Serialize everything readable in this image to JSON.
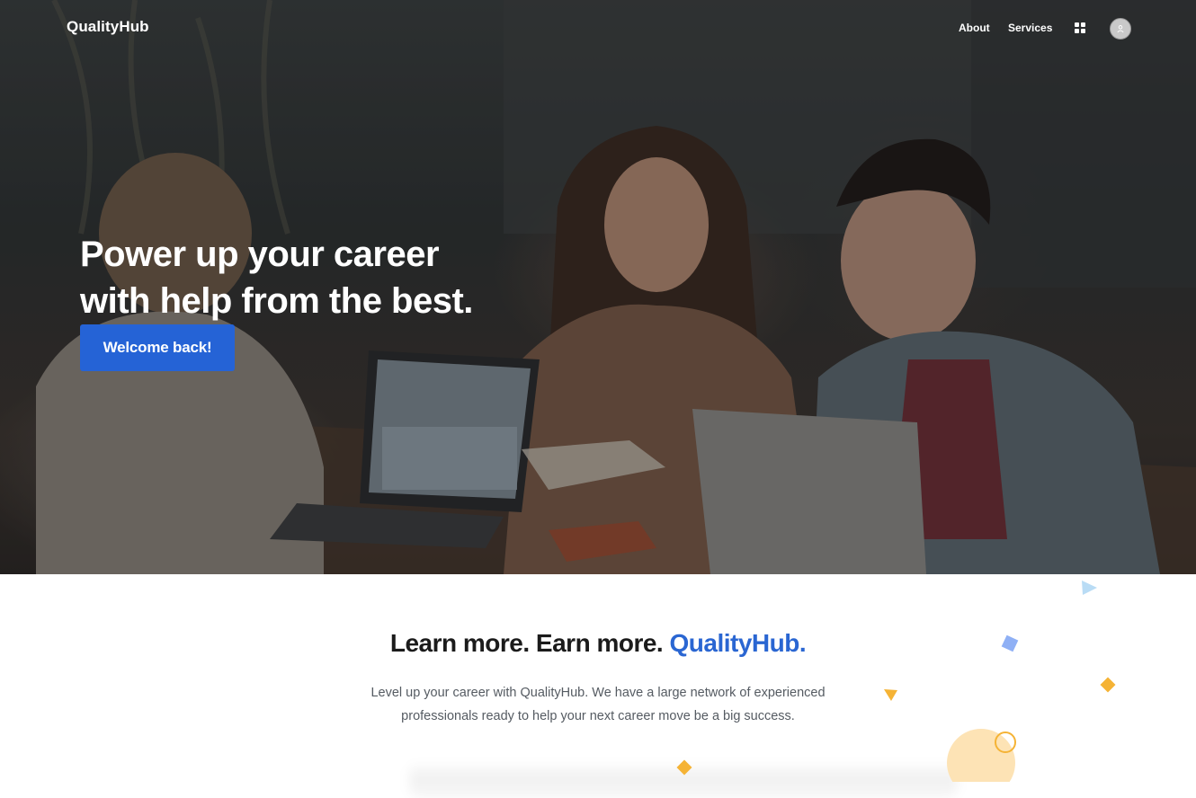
{
  "header": {
    "brand": "QualityHub",
    "nav": [
      {
        "label": "About"
      },
      {
        "label": "Services"
      }
    ]
  },
  "hero": {
    "title_line1": "Power up your career",
    "title_line2": "with help from the best.",
    "cta_label": "Welcome back!"
  },
  "intro": {
    "title_main": "Learn more. Earn more. ",
    "title_accent": "QualityHub.",
    "text": "Level up your career with QualityHub. We have a large network of experienced professionals ready to help your next career move be a big success."
  },
  "colors": {
    "accent": "#2563d6",
    "accent_text": "#2a66d2",
    "decor_orange": "#f5b335",
    "decor_blue": "#8fb0f5",
    "decor_light_blue": "#b9dcf5",
    "decor_peach": "#fde3b5"
  },
  "icons": {
    "apps": "grid-icon",
    "profile": "avatar"
  }
}
